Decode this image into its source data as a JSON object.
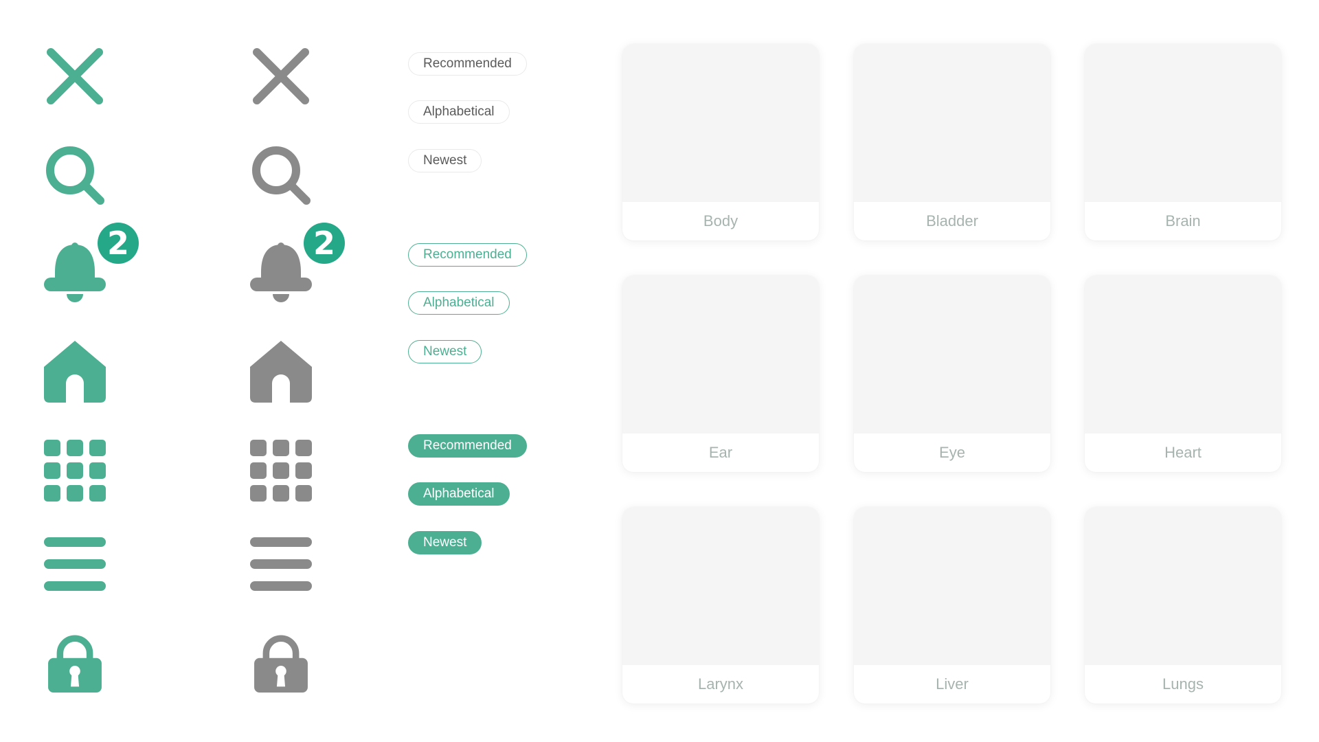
{
  "colors": {
    "accent": "#4caf91",
    "badge_green": "#24a888",
    "neutral": "#8a8a8a",
    "card_image": "#f5f5f5",
    "card_label": "#a6b3ae"
  },
  "icon_sets": [
    {
      "variant": "green",
      "icons": [
        "close-icon",
        "search-icon",
        "bell-icon",
        "home-icon",
        "grid-icon",
        "menu-icon",
        "lock-icon"
      ],
      "notification_badge": "2"
    },
    {
      "variant": "gray",
      "icons": [
        "close-icon",
        "search-icon",
        "bell-icon",
        "home-icon",
        "grid-icon",
        "menu-icon",
        "lock-icon"
      ],
      "notification_badge": "2"
    }
  ],
  "chip_groups": [
    {
      "style": "plain",
      "chips": [
        "Recommended",
        "Alphabetical",
        "Newest"
      ]
    },
    {
      "style": "outline",
      "chips": [
        "Recommended",
        "Alphabetical",
        "Newest"
      ]
    },
    {
      "style": "filled",
      "chips": [
        "Recommended",
        "Alphabetical",
        "Newest"
      ]
    }
  ],
  "cards": [
    {
      "label": "Body"
    },
    {
      "label": "Bladder"
    },
    {
      "label": "Brain"
    },
    {
      "label": "Ear"
    },
    {
      "label": "Eye"
    },
    {
      "label": "Heart"
    },
    {
      "label": "Larynx"
    },
    {
      "label": "Liver"
    },
    {
      "label": "Lungs"
    }
  ]
}
